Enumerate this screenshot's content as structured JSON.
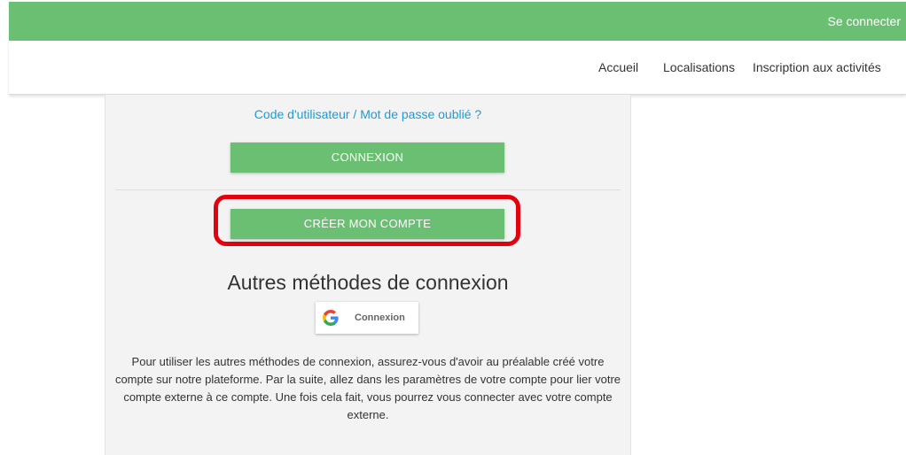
{
  "topbar": {
    "login_label": "Se connecter"
  },
  "nav": {
    "items": [
      "Accueil",
      "Localisations",
      "Inscription aux activités"
    ]
  },
  "login_panel": {
    "forgot_link": "Code d'utilisateur / Mot de passe oublié ?",
    "login_button": "CONNEXION",
    "create_account_button": "CRÉER MON COMPTE",
    "other_methods_title": "Autres méthodes de connexion",
    "google_button_label": "Connexion",
    "info_text": "Pour utiliser les autres méthodes de connexion, assurez-vous d'avoir au préalable créé votre compte sur notre plateforme. Par la suite, allez dans les paramètres de votre compte pour lier votre compte externe à ce compte. Une fois cela fait, vous pourrez vous connecter avec votre compte externe."
  },
  "colors": {
    "brand_green": "#6abf72",
    "link_blue": "#1e9ad6",
    "highlight_red": "#e3000f",
    "panel_bg": "#f3f3f3"
  },
  "icons": {
    "google": "google-logo-icon"
  }
}
